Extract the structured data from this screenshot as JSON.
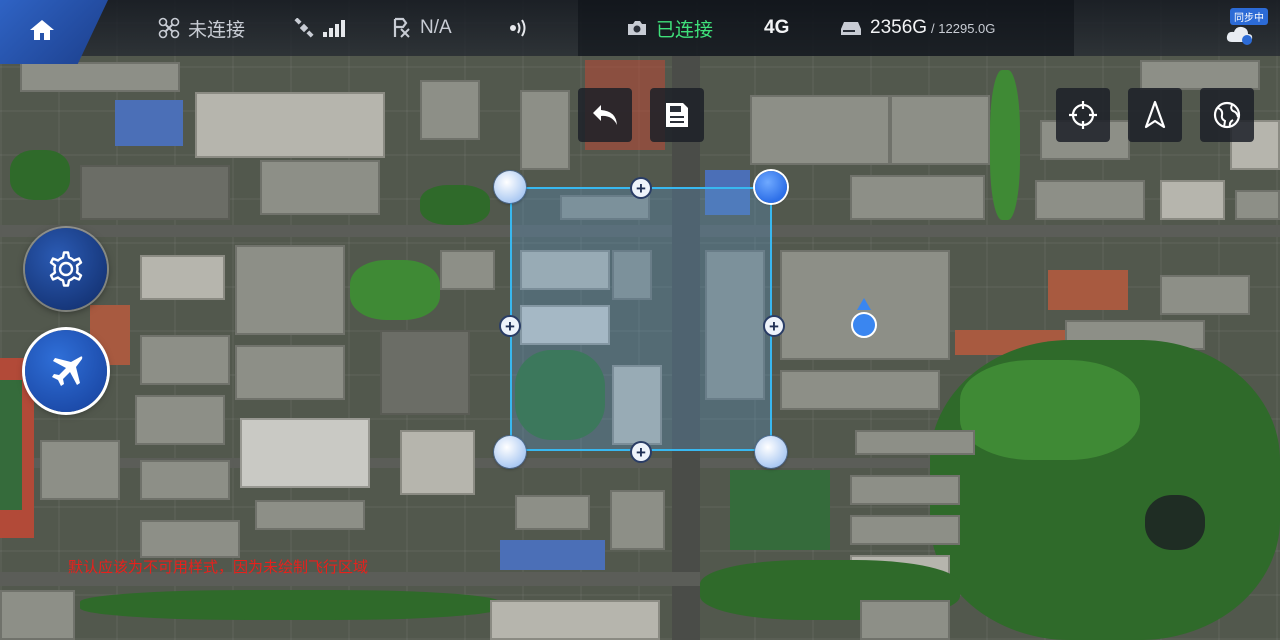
{
  "status_bar": {
    "link_status": "未连接",
    "signal_strength": 4,
    "rtk_status": "N/A",
    "camera_status": "已连接",
    "network": "4G",
    "storage_used": "2356G",
    "storage_total": "/ 12295.0G",
    "sync_label": "同步中"
  },
  "colors": {
    "accent": "#2c6bd6",
    "connected": "#3fe07a",
    "area_border": "#38b8f0",
    "hint": "#e8201c"
  },
  "icons": [
    "home-icon",
    "drone-icon",
    "satellite-icon",
    "signal-icon",
    "rtk-icon",
    "rc-signal-icon",
    "camera-icon",
    "hdd-icon",
    "cloud-sync-icon",
    "undo-icon",
    "save-icon",
    "locate-icon",
    "north-icon",
    "globe-icon",
    "settings-icon",
    "airplane-icon"
  ],
  "hint_text": "默认应该为不可用样式，因为未绘制飞行区域"
}
